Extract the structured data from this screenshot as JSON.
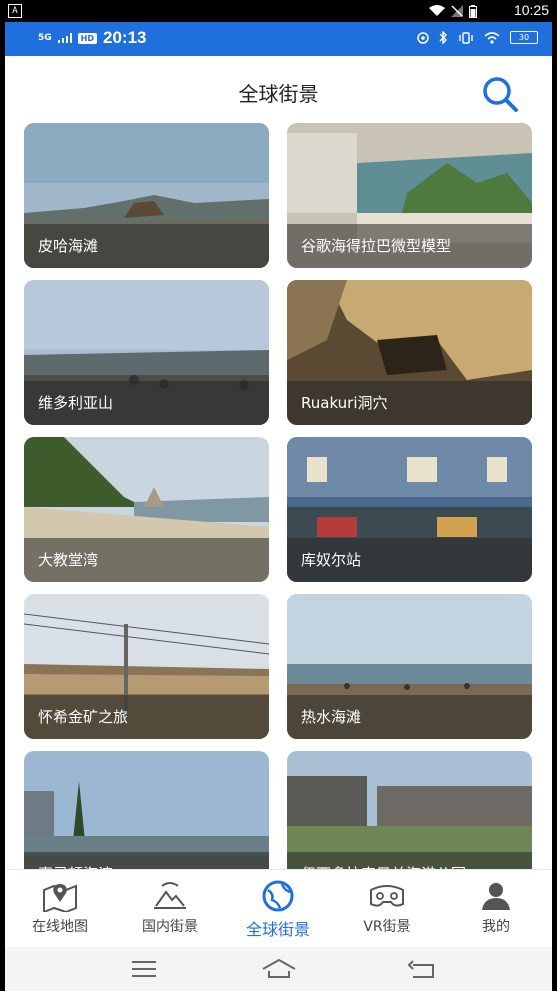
{
  "outer_status": {
    "badge": "A",
    "time": "10:25"
  },
  "inner_status": {
    "network": "5G",
    "hd": "HD",
    "time": "20:13",
    "battery": "30"
  },
  "header": {
    "title": "全球街景",
    "search_icon": "search-icon",
    "accent_color": "#1f6fdc"
  },
  "cards": [
    {
      "caption": "皮哈海滩"
    },
    {
      "caption": "谷歌海得拉巴微型模型"
    },
    {
      "caption": "维多利亚山"
    },
    {
      "caption": "Ruakuri洞穴"
    },
    {
      "caption": "大教堂湾"
    },
    {
      "caption": "库奴尔站"
    },
    {
      "caption": "怀希金矿之旅"
    },
    {
      "caption": "热水海滩"
    },
    {
      "caption": "惠灵顿海滨"
    },
    {
      "caption": "伊西多拉表兄弟海港公园"
    }
  ],
  "bottom_nav": {
    "items": [
      {
        "label": "在线地图",
        "icon": "map-pin-icon",
        "active": false
      },
      {
        "label": "国内街景",
        "icon": "mountain-icon",
        "active": false
      },
      {
        "label": "全球街景",
        "icon": "globe-icon",
        "active": true
      },
      {
        "label": "VR街景",
        "icon": "vr-headset-icon",
        "active": false
      },
      {
        "label": "我的",
        "icon": "user-icon",
        "active": false
      }
    ]
  }
}
